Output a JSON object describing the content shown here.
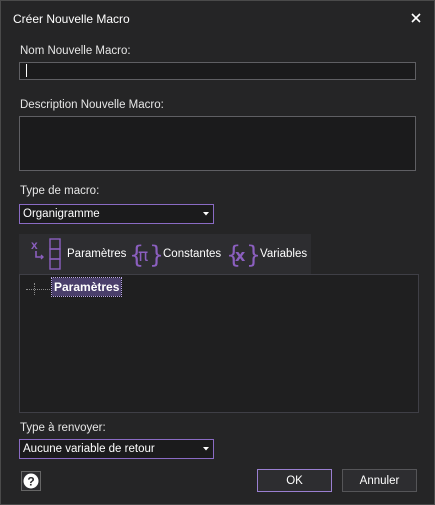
{
  "window": {
    "title": "Créer Nouvelle Macro"
  },
  "name_field": {
    "label": "Nom Nouvelle Macro:",
    "value": ""
  },
  "description_field": {
    "label": "Description Nouvelle Macro:",
    "value": ""
  },
  "macro_type": {
    "label": "Type de macro:",
    "selected": "Organigramme"
  },
  "toolbar": {
    "items": [
      {
        "label": "Paramètres",
        "icon": "parameters-icon"
      },
      {
        "label": "Constantes",
        "icon": "pi-braces-icon"
      },
      {
        "label": "Variables",
        "icon": "x-braces-icon"
      }
    ]
  },
  "tree": {
    "node_label": "Paramètres"
  },
  "return_type": {
    "label": "Type à renvoyer:",
    "selected": "Aucune variable de retour"
  },
  "buttons": {
    "ok": "OK",
    "cancel": "Annuler"
  },
  "colors": {
    "accent": "#8a6bc4",
    "background": "#252526",
    "icon_purple": "#8b5fbf"
  }
}
